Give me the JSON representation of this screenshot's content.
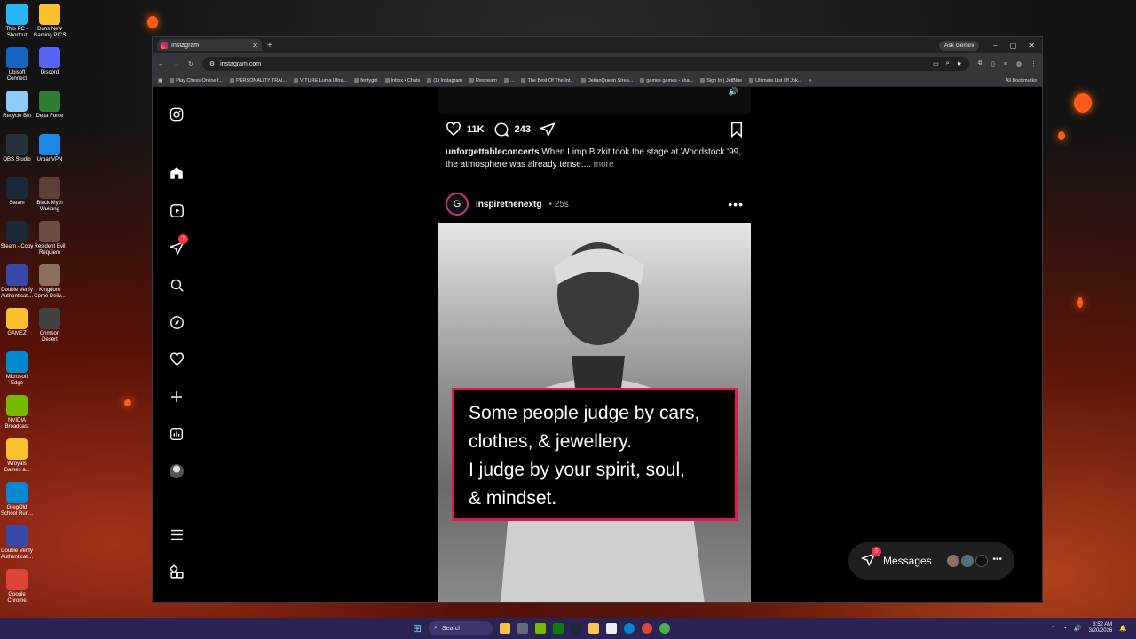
{
  "desktop": {
    "icons": [
      {
        "label": "This PC - Shortcut",
        "color": "#29b6f6"
      },
      {
        "label": "Dans New Gaming PICS",
        "color": "#fbc02d"
      },
      {
        "label": "Ubisoft Connect",
        "color": "#1565c0"
      },
      {
        "label": "Discord",
        "color": "#5865f2"
      },
      {
        "label": "Recycle Bin",
        "color": "#90caf9"
      },
      {
        "label": "Delta Force",
        "color": "#2e7d32"
      },
      {
        "label": "OBS Studio",
        "color": "#263238"
      },
      {
        "label": "UrbanVPN",
        "color": "#1e88e5"
      },
      {
        "label": "Steam",
        "color": "#1b2838"
      },
      {
        "label": "Black Myth Wukong",
        "color": "#5d4037"
      },
      {
        "label": "Steam - Copy",
        "color": "#1b2838"
      },
      {
        "label": "Resident Evil Requiem",
        "color": "#6d4c41"
      },
      {
        "label": "Double Verify Authenticati...",
        "color": "#3949ab"
      },
      {
        "label": "Kingdom Come Deliv...",
        "color": "#8d6e63"
      },
      {
        "label": "GAMEZ",
        "color": "#fbc02d"
      },
      {
        "label": "Crimson Desert",
        "color": "#424242"
      },
      {
        "label": "Microsoft Edge",
        "color": "#0288d1"
      },
      {
        "label": "NVIDIA Broadcast",
        "color": "#76b900"
      },
      {
        "label": "Wroyals Games a...",
        "color": "#fbc02d"
      },
      {
        "label": "GregOld School Run...",
        "color": "#0288d1"
      },
      {
        "label": "Double Verify Authenticati...",
        "color": "#3949ab"
      },
      {
        "label": "Google Chrome",
        "color": "#db4437"
      }
    ]
  },
  "browser": {
    "tab_title": "Instagram",
    "new_tab": "+",
    "gemini_label": "Ask Gemini",
    "url": "instagram.com",
    "bookmarks": [
      "Play Chess Online f...",
      "PERSONALITY TRAI...",
      "VITURE Luma Ultra...",
      "fentygirl",
      "Inbox • Chats",
      "(1) Instagram",
      "Restream",
      "...",
      "The Best Of The Int...",
      "DeilanQueen Strea...",
      "games games - sha...",
      "Sign In | JetBlue",
      "Ultimate List Of Jok..."
    ],
    "all_bookmarks": "All Bookmarks"
  },
  "instagram": {
    "nav_badge": "7",
    "prev_post": {
      "likes": "11K",
      "comments": "243",
      "caption_user": "unforgettableconcerts",
      "caption_text": "When Limp Bizkit took the stage at Woodstock '99, the atmosphere was already tense....",
      "more": "more"
    },
    "post": {
      "avatar_letter": "G",
      "username": "inspirethenextg",
      "time": "• 25s",
      "quote_lines": [
        "Some people judge by cars,",
        "clothes, & jewellery.",
        "I judge by your spirit, soul,",
        "& mindset."
      ]
    },
    "messages": {
      "label": "Messages",
      "badge": "5"
    }
  },
  "taskbar": {
    "search": "Search",
    "time": "8:52 AM",
    "date": "3/20/2026"
  }
}
